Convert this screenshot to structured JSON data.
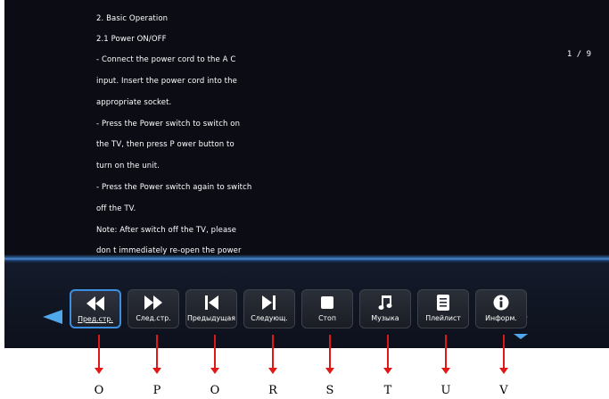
{
  "document": {
    "lines": [
      "2. Basic Operation",
      "2.1 Power ON/OFF",
      "- Connect the power cord to the A C",
      "input. Insert the power cord into the",
      "appropriate socket.",
      "- Press the Power switch to switch on",
      "the TV, then press P ower button to",
      "turn on the unit.",
      "- Press the Power switch again to switch",
      "off the TV.",
      "Note: After switch off the TV, please",
      "don t immediately re-open the power"
    ],
    "page_indicator": "1 / 9"
  },
  "toolbar": {
    "buttons": [
      {
        "label": "Пред.стр.",
        "icon": "rewind-icon"
      },
      {
        "label": "След.стр.",
        "icon": "fast-forward-icon"
      },
      {
        "label": "Предыдущая",
        "icon": "skip-previous-icon"
      },
      {
        "label": "Следующ.",
        "icon": "skip-next-icon"
      },
      {
        "label": "Стоп",
        "icon": "stop-icon"
      },
      {
        "label": "Музыка",
        "icon": "music-note-icon"
      },
      {
        "label": "Плейлист",
        "icon": "playlist-icon"
      },
      {
        "label": "Информ.",
        "icon": "info-icon"
      }
    ],
    "active_index": 0,
    "accent_color": "#3a8fe0"
  },
  "callouts": [
    "O",
    "P",
    "O",
    "R",
    "S",
    "T",
    "U",
    "V"
  ]
}
